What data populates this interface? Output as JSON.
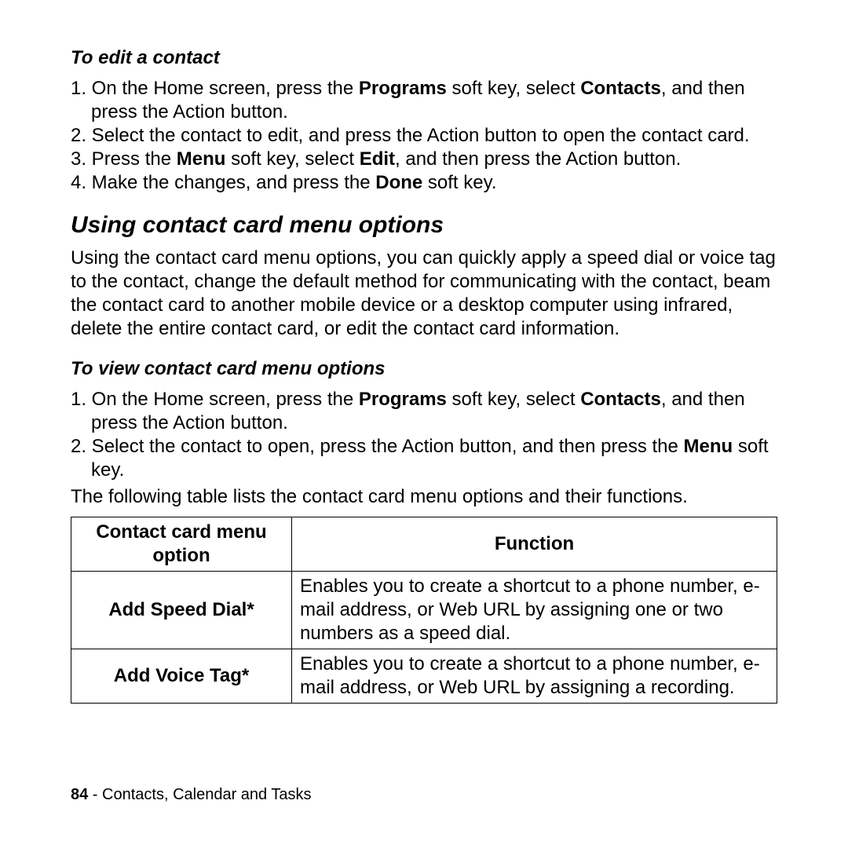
{
  "edit": {
    "heading": "To edit a contact",
    "s1a": "1. On the Home screen, press the ",
    "s1b": "Programs",
    "s1c": " soft key, select ",
    "s1d": "Contacts",
    "s1e": ", and then press the Action button.",
    "s2": "2. Select the contact to edit, and press the Action button to open the contact card.",
    "s3a": "3. Press the ",
    "s3b": "Menu",
    "s3c": " soft key, select ",
    "s3d": "Edit",
    "s3e": ", and then press the Action button.",
    "s4a": "4. Make the changes, and press the ",
    "s4b": "Done",
    "s4c": " soft key."
  },
  "main": {
    "heading": "Using contact card menu options",
    "para": "Using the contact card menu options, you can quickly apply a speed dial or voice tag to the contact, change the default method for communicating with the contact, beam the contact card to another mobile device or a desktop computer using infrared, delete the entire contact card, or edit the contact card information."
  },
  "view": {
    "heading": "To view contact card menu options",
    "s1a": "1. On the Home screen, press the ",
    "s1b": "Programs",
    "s1c": " soft key, select ",
    "s1d": "Contacts",
    "s1e": ", and then press the Action button.",
    "s2a": "2. Select the contact to open, press the Action button, and then press the ",
    "s2b": "Menu",
    "s2c": " soft key.",
    "after": "The following table lists the contact card menu options and their functions."
  },
  "table": {
    "h1": "Contact card menu option",
    "h2": "Function",
    "r1o": "Add Speed Dial*",
    "r1f": "Enables you to create a shortcut to a phone number, e-mail address, or Web URL by assigning one or two numbers as a speed dial.",
    "r2o": "Add Voice Tag*",
    "r2f": "Enables you to create a shortcut to a phone number, e-mail address, or Web URL by assigning a recording."
  },
  "footer": {
    "page": "84",
    "sep": " - ",
    "section": "Contacts, Calendar and Tasks"
  }
}
